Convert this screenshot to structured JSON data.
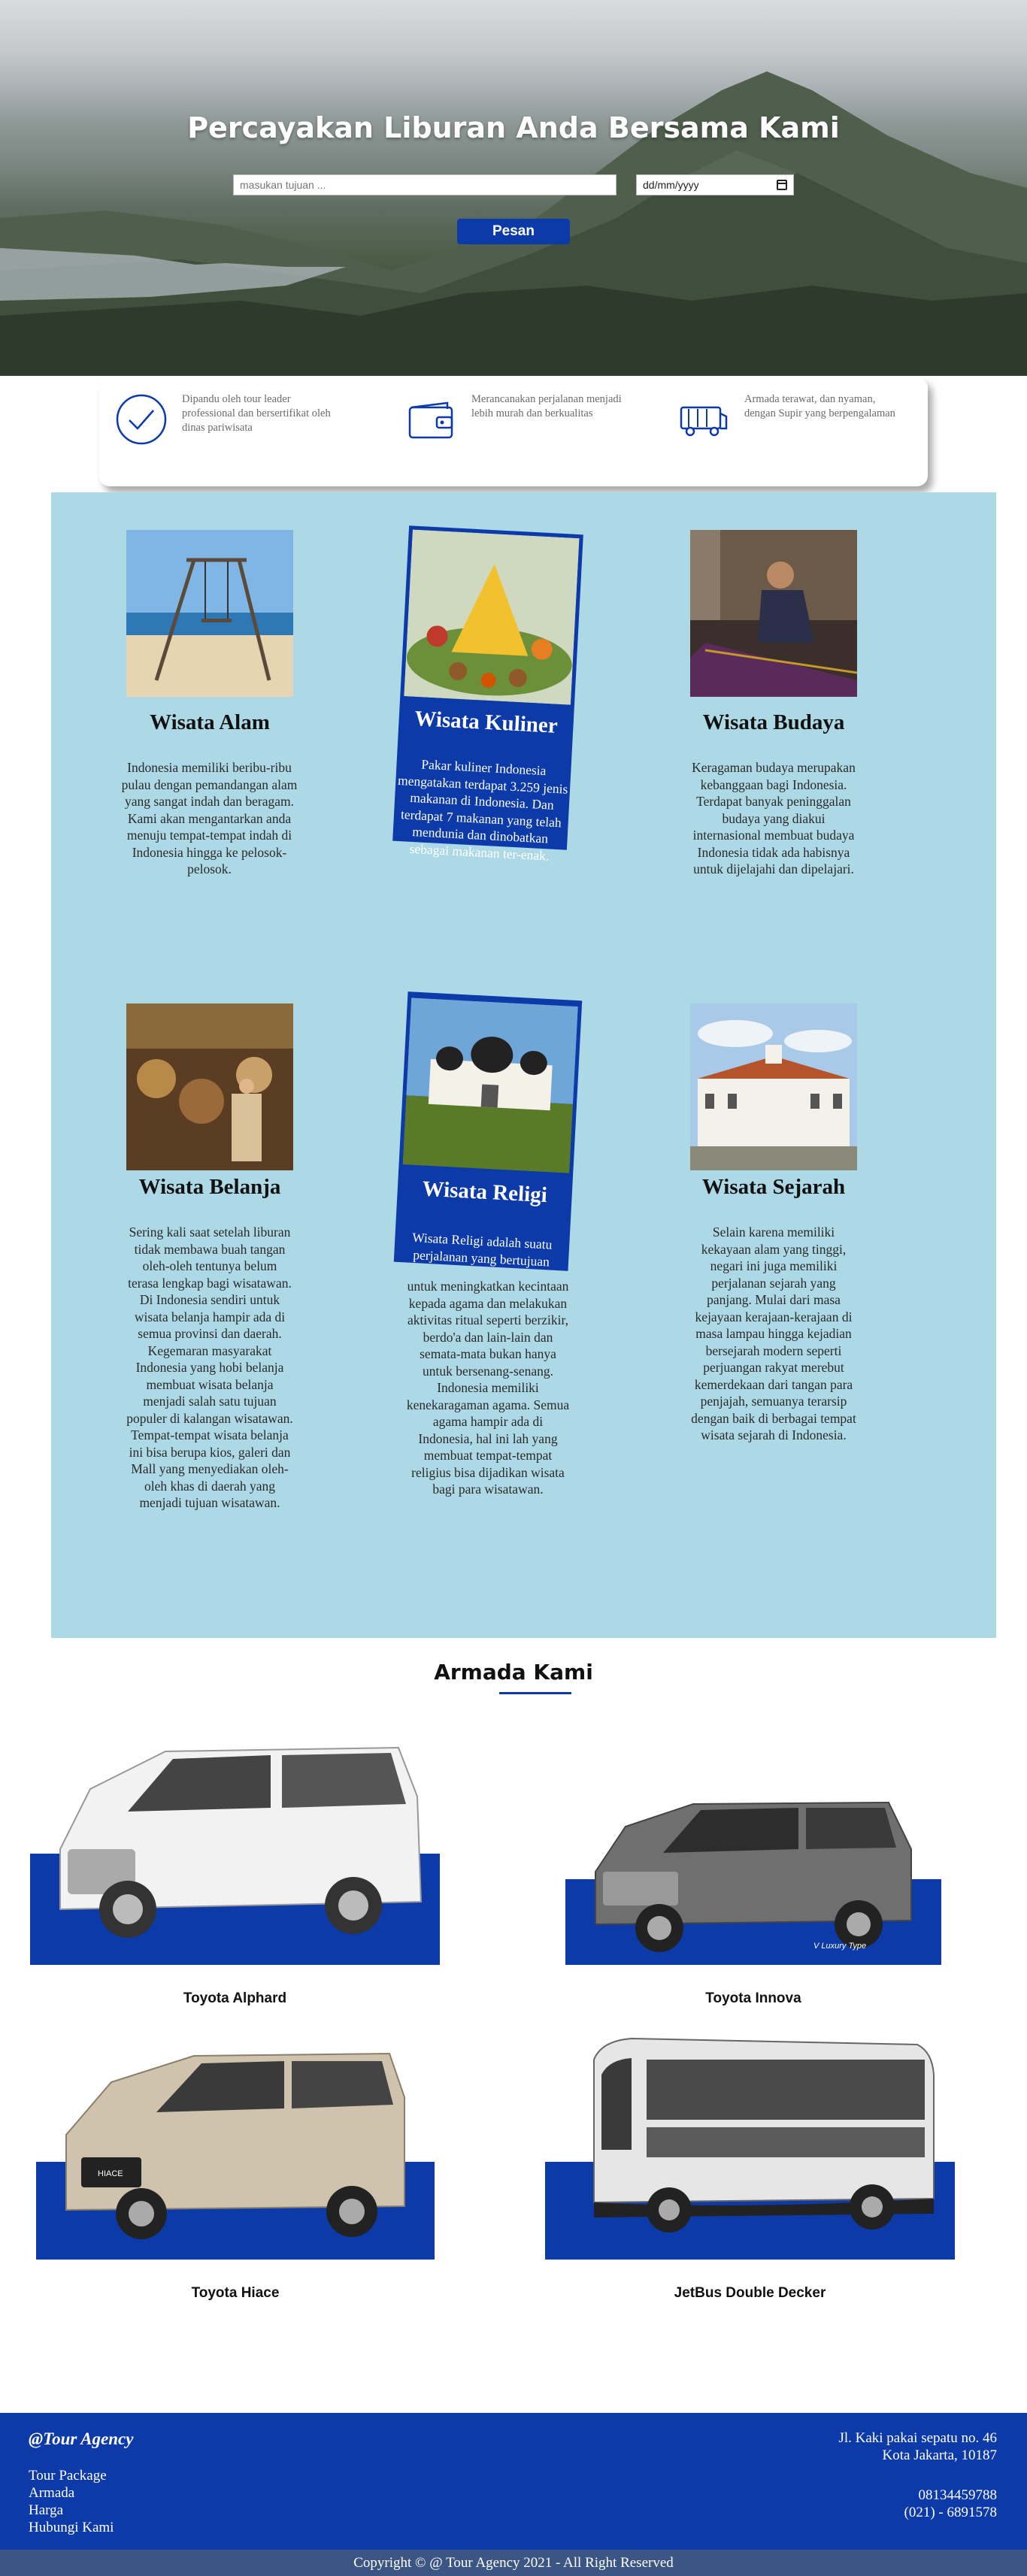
{
  "hero": {
    "title": "Percayakan Liburan Anda Bersama Kami",
    "destination_placeholder": "masukan tujuan ...",
    "date_value": "dd/mm/yyyy",
    "order_button": "Pesan"
  },
  "features": [
    {
      "icon": "check-circle-icon",
      "text": "Dipandu oleh tour leader professional dan bersertifikat oleh dinas pariwisata"
    },
    {
      "icon": "wallet-icon",
      "text": "Merancanakan perjalanan menjadi lebih murah dan berkualitas"
    },
    {
      "icon": "bus-icon",
      "text": "Armada terawat, dan nyaman, dengan Supir yang berpengalaman"
    }
  ],
  "tours": [
    {
      "title": "Wisata Alam",
      "text": "Indonesia memiliki beribu-ribu pulau dengan pemandangan alam yang sangat indah dan beragam. Kami akan mengantarkan anda menuju tempat-tempat indah di Indonesia hingga ke pelosok-pelosok."
    },
    {
      "title": "Wisata Kuliner",
      "text": "Pakar kuliner Indonesia mengatakan terdapat 3.259 jenis makanan di Indonesia. Dan terdapat 7 makanan yang telah mendunia dan dinobatkan sebagai makanan ter-enak."
    },
    {
      "title": "Wisata Budaya",
      "text": "Keragaman budaya merupakan kebanggaan bagi Indonesia. Terdapat banyak peninggalan budaya yang diakui internasional membuat budaya Indonesia tidak ada habisnya untuk dijelajahi dan dipelajari."
    },
    {
      "title": "Wisata Belanja",
      "text": "Sering kali saat setelah liburan tidak membawa buah tangan oleh-oleh tentunya belum terasa lengkap bagi wisatawan. Di Indonesia sendiri untuk wisata belanja hampir ada di semua provinsi dan daerah. Kegemaran masyarakat Indonesia yang hobi belanja membuat wisata belanja menjadi salah satu tujuan populer di kalangan wisatawan. Tempat-tempat wisata belanja ini bisa berupa kios, galeri dan Mall yang menyediakan oleh-oleh khas di daerah yang menjadi tujuan wisatawan."
    },
    {
      "title": "Wisata Religi",
      "text_top": "Wisata Religi adalah suatu perjalanan yang bertujuan",
      "text": "untuk meningkatkan kecintaan kepada agama dan melakukan aktivitas ritual seperti berzikir, berdo'a dan lain-lain dan semata-mata bukan hanya untuk bersenang-senang. Indonesia memiliki kenekaragaman agama. Semua agama hampir ada di Indonesia, hal ini lah yang membuat tempat-tempat religius bisa dijadikan wisata bagi para wisatawan."
    },
    {
      "title": "Wisata Sejarah",
      "text": "Selain karena memiliki kekayaan alam yang tinggi, negari ini juga memiliki perjalanan sejarah yang panjang. Mulai dari masa kejayaan kerajaan-kerajaan di masa lampau hingga kejadian bersejarah modern seperti perjuangan rakyat merebut kemerdekaan dari tangan para penjajah, semuanya terarsip dengan baik di berbagai tempat wisata sejarah di Indonesia."
    }
  ],
  "armada": {
    "title": "Armada Kami",
    "vehicles": [
      {
        "name": "Toyota Alphard"
      },
      {
        "name": "Toyota Innova",
        "badge": "V Luxury Type"
      },
      {
        "name": "Toyota Hiace",
        "plate": "HIACE"
      },
      {
        "name": "JetBus Double Decker"
      }
    ]
  },
  "footer": {
    "brand": "@Tour Agency",
    "links": [
      "Tour Package",
      "Armada",
      "Harga",
      "Hubungi Kami"
    ],
    "address_line1": "Jl. Kaki pakai sepatu no. 46",
    "address_line2": "Kota Jakarta, 10187",
    "phone1": "08134459788",
    "phone2": "(021) - 6891578",
    "copyright": "Copyright © @ Tour Agency 2021 - All Right Reserved"
  },
  "colors": {
    "accent": "#0d3aa9",
    "tours_bg": "#add8e6",
    "copyright_bg": "#3c5683"
  }
}
